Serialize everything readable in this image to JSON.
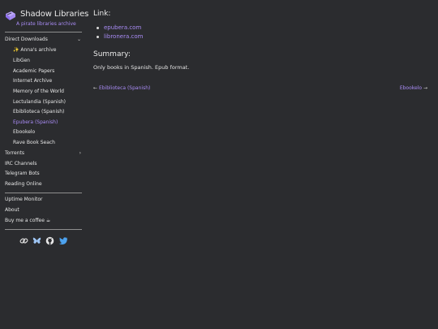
{
  "brand": {
    "title": "Shadow Libraries",
    "subtitle": "A pirate libraries archive",
    "accent_color": "#a98cf5",
    "logo_icon": "books-icon"
  },
  "sidebar": {
    "direct_downloads": {
      "label": "Direct Downloads",
      "expanded": true,
      "items": [
        {
          "label": "✨ Anna's archive"
        },
        {
          "label": "LibGen"
        },
        {
          "label": "Academic Papers"
        },
        {
          "label": "Internet Archive"
        },
        {
          "label": "Memory of the World"
        },
        {
          "label": "Lectulandia (Spanish)"
        },
        {
          "label": "Ebiblioteca (Spanish)"
        },
        {
          "label": "Epubera (Spanish)",
          "active": true
        },
        {
          "label": "Ebookelo"
        },
        {
          "label": "Rave Book Seach"
        }
      ]
    },
    "torrents": {
      "label": "Torrents"
    },
    "irc": {
      "label": "IRC Channels"
    },
    "telegram": {
      "label": "Telegram Bots"
    },
    "reading": {
      "label": "Reading Online"
    },
    "uptime": {
      "label": "Uptime Monitor"
    },
    "about": {
      "label": "About"
    },
    "coffee": {
      "label": "Buy me a coffee ☕"
    },
    "social": [
      "link-icon",
      "bluesky-icon",
      "github-icon",
      "twitter-icon"
    ]
  },
  "main": {
    "link_heading": "Link:",
    "links": [
      "epubera.com",
      "libronera.com"
    ],
    "summary_heading": "Summary:",
    "summary_text": "Only books in Spanish. Epub format.",
    "prev_label": "Ebiblioteca (Spanish)",
    "next_label": "Ebookelo"
  }
}
